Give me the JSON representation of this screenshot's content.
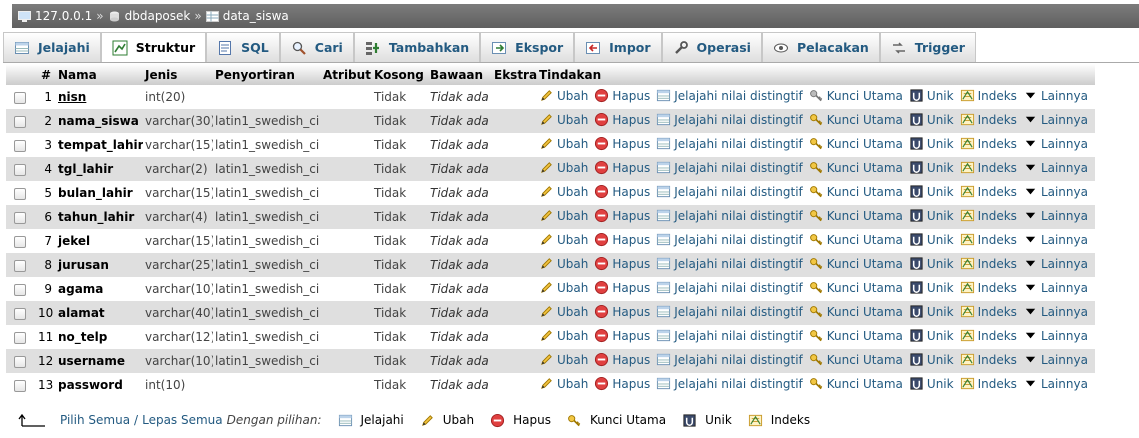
{
  "breadcrumb": {
    "server": "127.0.0.1",
    "database": "dbdaposek",
    "table": "data_siswa",
    "separator": "»"
  },
  "tabs": [
    {
      "label": "Jelajahi",
      "icon": "browse-icon"
    },
    {
      "label": "Struktur",
      "icon": "structure-icon",
      "active": true
    },
    {
      "label": "SQL",
      "icon": "sql-icon"
    },
    {
      "label": "Cari",
      "icon": "search-icon"
    },
    {
      "label": "Tambahkan",
      "icon": "insert-icon"
    },
    {
      "label": "Ekspor",
      "icon": "export-icon"
    },
    {
      "label": "Impor",
      "icon": "import-icon"
    },
    {
      "label": "Operasi",
      "icon": "wrench-icon"
    },
    {
      "label": "Pelacakan",
      "icon": "eye-icon"
    },
    {
      "label": "Trigger",
      "icon": "trigger-icon"
    }
  ],
  "columns": [
    "#",
    "Nama",
    "Jenis",
    "Penyortiran",
    "Atribut",
    "Kosong",
    "Bawaan",
    "Ekstra",
    "Tindakan"
  ],
  "actions": {
    "ubah": "Ubah",
    "hapus": "Hapus",
    "jelajahi": "Jelajahi nilai distingtif",
    "kunci": "Kunci Utama",
    "unik": "Unik",
    "indeks": "Indeks",
    "lainnya": "Lainnya"
  },
  "rows": [
    {
      "no": "1",
      "name": "nisn",
      "type": "int(20)",
      "collation": "",
      "attr": "",
      "null": "Tidak",
      "default": "Tidak ada",
      "extra": "",
      "primary": true
    },
    {
      "no": "2",
      "name": "nama_siswa",
      "type": "varchar(30)",
      "collation": "latin1_swedish_ci",
      "attr": "",
      "null": "Tidak",
      "default": "Tidak ada",
      "extra": ""
    },
    {
      "no": "3",
      "name": "tempat_lahir",
      "type": "varchar(15)",
      "collation": "latin1_swedish_ci",
      "attr": "",
      "null": "Tidak",
      "default": "Tidak ada",
      "extra": ""
    },
    {
      "no": "4",
      "name": "tgl_lahir",
      "type": "varchar(2)",
      "collation": "latin1_swedish_ci",
      "attr": "",
      "null": "Tidak",
      "default": "Tidak ada",
      "extra": ""
    },
    {
      "no": "5",
      "name": "bulan_lahir",
      "type": "varchar(15)",
      "collation": "latin1_swedish_ci",
      "attr": "",
      "null": "Tidak",
      "default": "Tidak ada",
      "extra": ""
    },
    {
      "no": "6",
      "name": "tahun_lahir",
      "type": "varchar(4)",
      "collation": "latin1_swedish_ci",
      "attr": "",
      "null": "Tidak",
      "default": "Tidak ada",
      "extra": ""
    },
    {
      "no": "7",
      "name": "jekel",
      "type": "varchar(15)",
      "collation": "latin1_swedish_ci",
      "attr": "",
      "null": "Tidak",
      "default": "Tidak ada",
      "extra": ""
    },
    {
      "no": "8",
      "name": "jurusan",
      "type": "varchar(25)",
      "collation": "latin1_swedish_ci",
      "attr": "",
      "null": "Tidak",
      "default": "Tidak ada",
      "extra": ""
    },
    {
      "no": "9",
      "name": "agama",
      "type": "varchar(10)",
      "collation": "latin1_swedish_ci",
      "attr": "",
      "null": "Tidak",
      "default": "Tidak ada",
      "extra": ""
    },
    {
      "no": "10",
      "name": "alamat",
      "type": "varchar(40)",
      "collation": "latin1_swedish_ci",
      "attr": "",
      "null": "Tidak",
      "default": "Tidak ada",
      "extra": ""
    },
    {
      "no": "11",
      "name": "no_telp",
      "type": "varchar(12)",
      "collation": "latin1_swedish_ci",
      "attr": "",
      "null": "Tidak",
      "default": "Tidak ada",
      "extra": ""
    },
    {
      "no": "12",
      "name": "username",
      "type": "varchar(10)",
      "collation": "latin1_swedish_ci",
      "attr": "",
      "null": "Tidak",
      "default": "Tidak ada",
      "extra": ""
    },
    {
      "no": "13",
      "name": "password",
      "type": "int(10)",
      "collation": "",
      "attr": "",
      "null": "Tidak",
      "default": "Tidak ada",
      "extra": ""
    }
  ],
  "footer": {
    "check_all": "Pilih Semua",
    "slash": "/",
    "uncheck_all": "Lepas Semua",
    "with_selected": "Dengan pilihan:",
    "actions": [
      {
        "label": "Jelajahi",
        "icon": "browse-icon"
      },
      {
        "label": "Ubah",
        "icon": "pencil-icon"
      },
      {
        "label": "Hapus",
        "icon": "delete-icon"
      },
      {
        "label": "Kunci Utama",
        "icon": "key-icon"
      },
      {
        "label": "Unik",
        "icon": "unique-icon"
      },
      {
        "label": "Indeks",
        "icon": "index-icon"
      }
    ]
  },
  "colors": {
    "link": "#235a81",
    "row_even": "#dfdfdf",
    "breadcrumb_bg": "#6b6b6b"
  }
}
